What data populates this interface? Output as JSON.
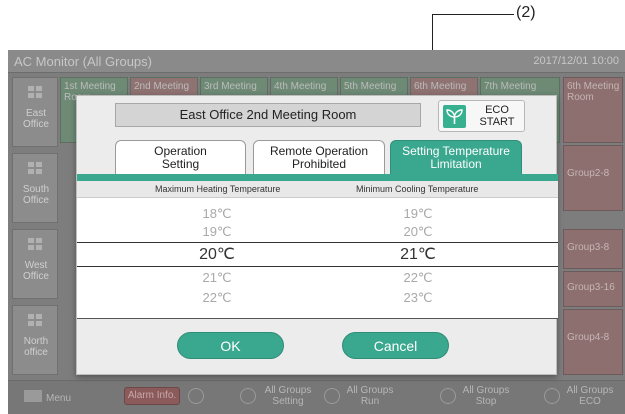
{
  "callout": {
    "label": "(2)"
  },
  "app": {
    "title": "AC Monitor (All Groups)",
    "datetime": "2017/12/01 10:00",
    "zones": [
      {
        "label": "East Office"
      },
      {
        "label": "South Office"
      },
      {
        "label": "West Office"
      },
      {
        "label": "North office"
      }
    ],
    "top_row": [
      "1st Meeting Room",
      "2nd Meeting",
      "3rd Meeting",
      "4th Meeting",
      "5th Meeting",
      "6th Meeting",
      "7th Meeting"
    ],
    "side_cells": [
      "6th Meeting Room",
      "Group2-8",
      "Group3-8",
      "Group3-16",
      "Group4-8"
    ],
    "bottom_bar": {
      "menu": "Menu",
      "alarm": "Alarm Info.",
      "setting": "All Groups Setting",
      "run": "All Groups Run",
      "stop": "All Groups Stop",
      "eco": "All Groups ECO"
    }
  },
  "modal": {
    "room_name": "East Office 2nd Meeting Room",
    "eco_button": {
      "line1": "ECO",
      "line2": "START"
    },
    "tabs": [
      {
        "line1": "Operation",
        "line2": "Setting",
        "active": false
      },
      {
        "line1": "Remote Operation",
        "line2": "Prohibited",
        "active": false
      },
      {
        "line1": "Setting Temperature",
        "line2": "Limitation",
        "active": true
      }
    ],
    "columns": {
      "heating": "Maximum Heating Temperature",
      "cooling": "Minimum Cooling Temperature"
    },
    "heating_values": [
      "18℃",
      "19℃",
      "20℃",
      "21℃",
      "22℃"
    ],
    "cooling_values": [
      "19℃",
      "20℃",
      "21℃",
      "22℃",
      "23℃"
    ],
    "selected_heating": "20℃",
    "selected_cooling": "21℃",
    "ok_label": "OK",
    "cancel_label": "Cancel"
  },
  "colors": {
    "accent": "#3aa78f",
    "eco_icon": "#37b08f"
  }
}
